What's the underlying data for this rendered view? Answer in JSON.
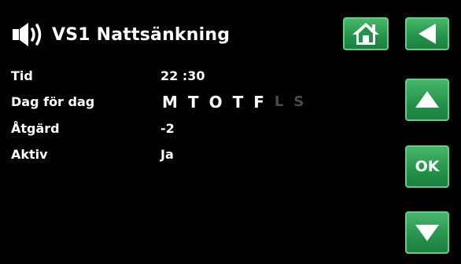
{
  "header": {
    "title": "VS1 Nattsänkning",
    "speaker_icon": "speaker-icon"
  },
  "buttons": {
    "home_icon": "home-icon",
    "back_icon": "back-arrow-icon",
    "up_icon": "up-arrow-icon",
    "ok_label": "OK",
    "down_icon": "down-arrow-icon",
    "color_green": "#23934a"
  },
  "settings": {
    "time_label": "Tid",
    "time_value": "22 :30",
    "days_label": "Dag för dag",
    "days": [
      {
        "letter": "M",
        "active": true
      },
      {
        "letter": "T",
        "active": true
      },
      {
        "letter": "O",
        "active": true
      },
      {
        "letter": "T",
        "active": true
      },
      {
        "letter": "F",
        "active": true
      },
      {
        "letter": "L",
        "active": false
      },
      {
        "letter": "S",
        "active": false
      }
    ],
    "action_label": "Åtgärd",
    "action_value": "-2",
    "active_label": "Aktiv",
    "active_value": "Ja"
  }
}
